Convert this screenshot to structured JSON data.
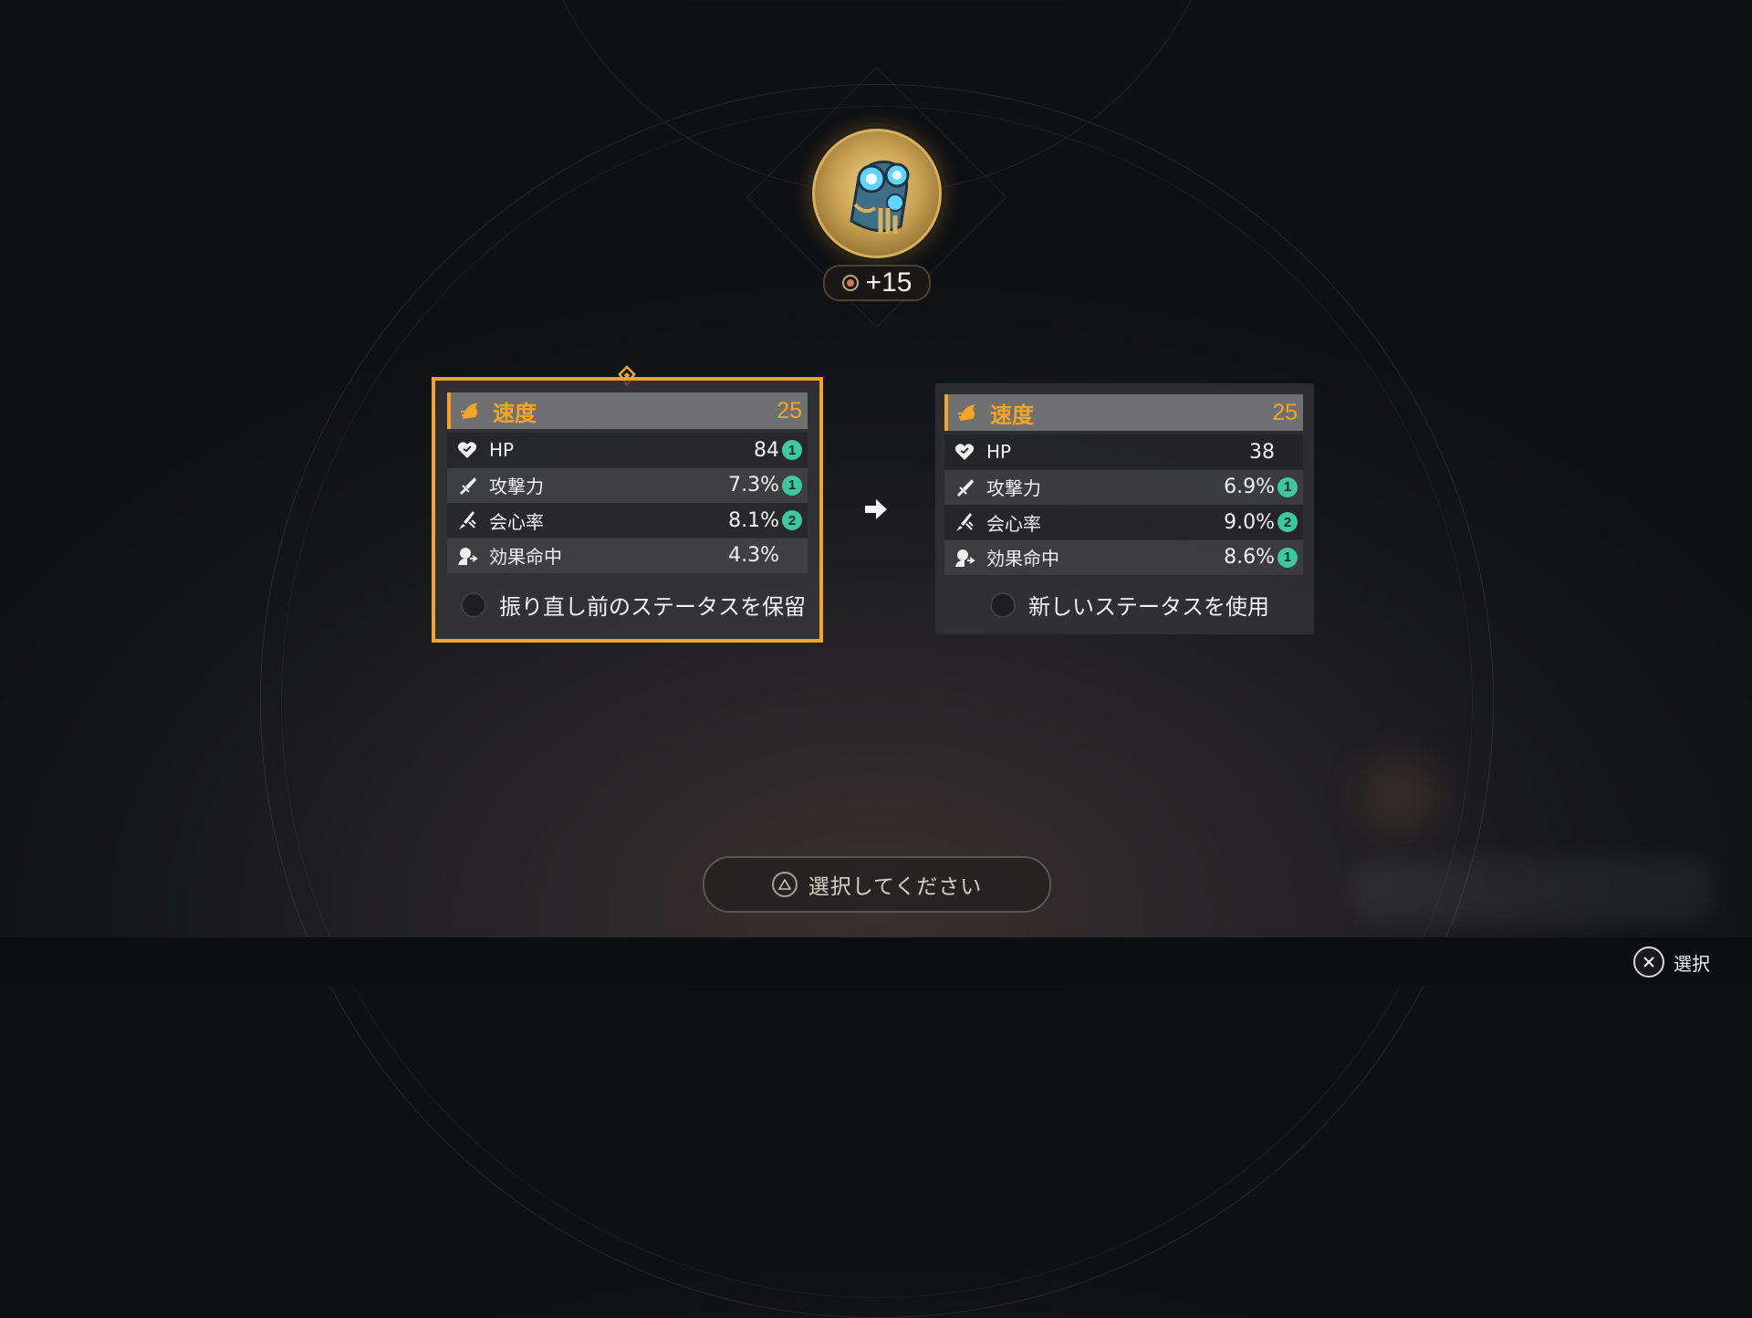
{
  "relic": {
    "icon": "relic-gauntlet-icon",
    "level": "+15",
    "level_icon": "upgrade-dot-icon"
  },
  "left_panel": {
    "main_stat": {
      "icon": "speed-icon",
      "name": "速度",
      "value": "25"
    },
    "substats": [
      {
        "icon": "hp-heart-icon",
        "name": "HP",
        "value": "84",
        "rolls": "1"
      },
      {
        "icon": "attack-sword-icon",
        "name": "攻撃力",
        "value": "7.3%",
        "rolls": "1"
      },
      {
        "icon": "crit-rate-icon",
        "name": "会心率",
        "value": "8.1%",
        "rolls": "2"
      },
      {
        "icon": "effect-hit-icon",
        "name": "効果命中",
        "value": "4.3%",
        "rolls": ""
      }
    ],
    "option_label": "振り直し前のステータスを保留",
    "selected": true
  },
  "right_panel": {
    "main_stat": {
      "icon": "speed-icon",
      "name": "速度",
      "value": "25"
    },
    "substats": [
      {
        "icon": "hp-heart-icon",
        "name": "HP",
        "value": "38",
        "rolls": ""
      },
      {
        "icon": "attack-sword-icon",
        "name": "攻撃力",
        "value": "6.9%",
        "rolls": "1"
      },
      {
        "icon": "crit-rate-icon",
        "name": "会心率",
        "value": "9.0%",
        "rolls": "2"
      },
      {
        "icon": "effect-hit-icon",
        "name": "効果命中",
        "value": "8.6%",
        "rolls": "1"
      }
    ],
    "option_label": "新しいステータスを使用",
    "selected": false
  },
  "prompt": {
    "icon": "triangle-button-icon",
    "text": "選択してください"
  },
  "footer": {
    "confirm_icon": "cross-button-icon",
    "confirm_label": "選択"
  },
  "colors": {
    "accent": "#f3a526",
    "roll_badge": "#3fc8a0",
    "panel": "#3a3a3e"
  }
}
